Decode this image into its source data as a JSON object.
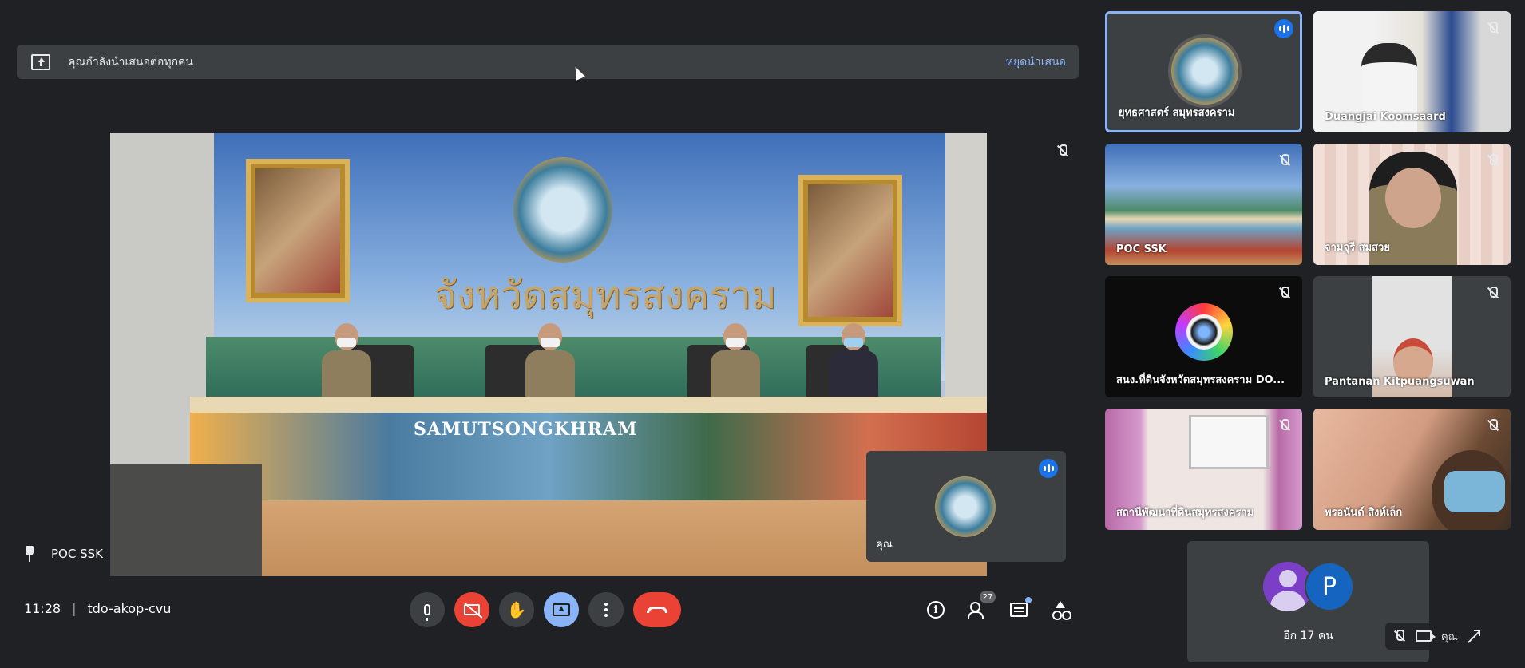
{
  "banner": {
    "text": "คุณกำลังนำเสนอต่อทุกคน",
    "stop_label": "หยุดนำเสนอ"
  },
  "stage": {
    "headline": "จังหวัดสมุทรสงคราม",
    "banner_title": "SAMUTSONGKHRAM",
    "pinned_name": "POC SSK"
  },
  "self_tile": {
    "name": "คุณ"
  },
  "participants": [
    {
      "name": "ยุทธศาสตร์ สมุทรสงคราม",
      "speaking": true,
      "muted": false
    },
    {
      "name": "Duangjai Koomsaard",
      "speaking": false,
      "muted": true
    },
    {
      "name": "POC SSK",
      "speaking": false,
      "muted": true
    },
    {
      "name": "จามจุรี สมสวย",
      "speaking": false,
      "muted": true
    },
    {
      "name": "สนง.ที่ดินจังหวัดสมุทรสงคราม DO...",
      "speaking": false,
      "muted": true
    },
    {
      "name": "Pantanan Kitpuangsuwan",
      "speaking": false,
      "muted": true
    },
    {
      "name": "สถานีพัฒนาที่ดินสมุทรสงคราม",
      "speaking": false,
      "muted": true
    },
    {
      "name": "พรอนันต์ สิงห์เล็ก",
      "speaking": false,
      "muted": true
    }
  ],
  "more": {
    "avatar_letter": "P",
    "text": "อีก 17 คน"
  },
  "self_strip": {
    "name": "คุณ"
  },
  "meeting": {
    "time": "11:28",
    "code": "tdo-akop-cvu"
  },
  "toolbar": {
    "people_count": "27"
  },
  "colors": {
    "background": "#202124",
    "surface": "#3c4043",
    "accent": "#8ab4f8",
    "danger": "#ea4335",
    "speaking": "#1a73e8"
  }
}
